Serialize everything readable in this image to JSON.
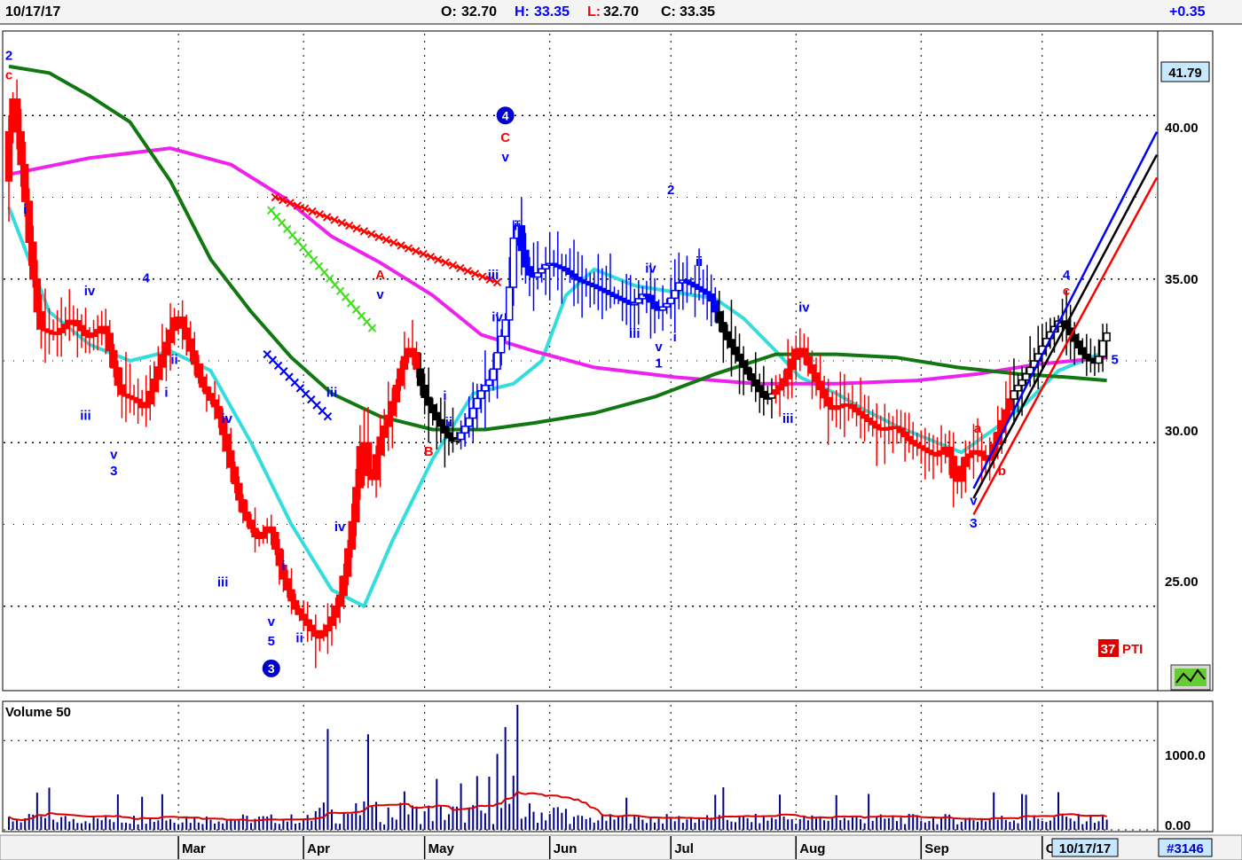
{
  "header": {
    "date": "10/17/17",
    "open_label": "O:",
    "open": "32.70",
    "high_label": "H:",
    "high": "33.35",
    "low_label": "L:",
    "low": "32.70",
    "close_label": "C:",
    "close": "33.35",
    "change": "+0.35"
  },
  "colors": {
    "up": "#0000ff",
    "down": "#ff0000",
    "neutral": "#000000",
    "ma_short": "#33dddd",
    "ma_mid": "#ee22ee",
    "ma_long": "#117711",
    "volume_bar": "#000088",
    "volume_ma": "#dd0000",
    "label_bg": "#c8e8ff"
  },
  "price_panel": {
    "last_price_label": "41.79",
    "y_ticks": [
      "40.00",
      "35.00",
      "30.00",
      "25.00"
    ],
    "indicator_value": "37",
    "indicator_name": "PTI"
  },
  "volume_panel": {
    "title": "Volume 50",
    "y_ticks": [
      "1000.0",
      "0.00"
    ]
  },
  "x_axis": {
    "months": [
      "Mar",
      "Apr",
      "May",
      "Jun",
      "Jul",
      "Aug",
      "Sep",
      "O"
    ],
    "current_date": "10/17/17",
    "symbol_id": "#3146"
  },
  "chart_data": {
    "type": "candlestick",
    "ylim": [
      22.5,
      42.5
    ],
    "volume_ylim": [
      0,
      1400
    ],
    "x_range_days": [
      0,
      248
    ],
    "month_starts": [
      {
        "label": "Mar",
        "day": 42
      },
      {
        "label": "Apr",
        "day": 73
      },
      {
        "label": "May",
        "day": 103
      },
      {
        "label": "Jun",
        "day": 134
      },
      {
        "label": "Jul",
        "day": 164
      },
      {
        "label": "Aug",
        "day": 195
      },
      {
        "label": "Sep",
        "day": 226
      },
      {
        "label": "O",
        "day": 256
      }
    ],
    "price_path": [
      [
        0,
        38.0
      ],
      [
        1,
        41.0
      ],
      [
        4,
        38.0
      ],
      [
        6,
        35.5
      ],
      [
        8,
        33.5
      ],
      [
        12,
        33.3
      ],
      [
        16,
        33.8
      ],
      [
        20,
        33.2
      ],
      [
        24,
        33.6
      ],
      [
        28,
        31.5
      ],
      [
        32,
        31.3
      ],
      [
        34,
        31.0
      ],
      [
        38,
        32.5
      ],
      [
        42,
        34.0
      ],
      [
        45,
        33.0
      ],
      [
        48,
        31.8
      ],
      [
        52,
        31.0
      ],
      [
        55,
        29.5
      ],
      [
        58,
        28.0
      ],
      [
        62,
        27.0
      ],
      [
        65,
        27.5
      ],
      [
        68,
        26.0
      ],
      [
        71,
        25.0
      ],
      [
        74,
        24.5
      ],
      [
        77,
        24.0
      ],
      [
        80,
        24.5
      ],
      [
        83,
        25.5
      ],
      [
        86,
        28.0
      ],
      [
        88,
        30.5
      ],
      [
        90,
        28.5
      ],
      [
        92,
        30.0
      ],
      [
        95,
        31.0
      ],
      [
        98,
        32.5
      ],
      [
        100,
        33.0
      ],
      [
        103,
        31.5
      ],
      [
        106,
        30.8
      ],
      [
        109,
        30.2
      ],
      [
        111,
        30.0
      ],
      [
        114,
        30.6
      ],
      [
        117,
        31.5
      ],
      [
        120,
        32.0
      ],
      [
        122,
        33.0
      ],
      [
        124,
        34.0
      ],
      [
        126,
        37.0
      ],
      [
        128,
        35.5
      ],
      [
        130,
        35.0
      ],
      [
        134,
        35.5
      ],
      [
        138,
        35.3
      ],
      [
        141,
        35.0
      ],
      [
        145,
        34.8
      ],
      [
        150,
        34.5
      ],
      [
        155,
        34.2
      ],
      [
        158,
        34.6
      ],
      [
        161,
        34.0
      ],
      [
        164,
        34.3
      ],
      [
        167,
        35.0
      ],
      [
        170,
        34.8
      ],
      [
        174,
        34.5
      ],
      [
        177,
        33.5
      ],
      [
        180,
        32.8
      ],
      [
        184,
        32.0
      ],
      [
        188,
        31.3
      ],
      [
        192,
        31.8
      ],
      [
        196,
        33.0
      ],
      [
        200,
        32.0
      ],
      [
        204,
        31.0
      ],
      [
        208,
        31.2
      ],
      [
        212,
        30.8
      ],
      [
        216,
        30.4
      ],
      [
        220,
        30.5
      ],
      [
        224,
        30.0
      ],
      [
        227,
        29.8
      ],
      [
        230,
        29.6
      ],
      [
        233,
        29.9
      ],
      [
        235,
        28.6
      ],
      [
        237,
        29.5
      ],
      [
        240,
        29.8
      ],
      [
        243,
        29.4
      ],
      [
        246,
        30.5
      ],
      [
        249,
        31.5
      ],
      [
        252,
        32.0
      ],
      [
        255,
        32.6
      ],
      [
        258,
        33.3
      ],
      [
        261,
        33.8
      ],
      [
        264,
        33.2
      ],
      [
        267,
        32.6
      ],
      [
        270,
        32.4
      ],
      [
        272,
        33.35
      ]
    ],
    "series": [
      {
        "name": "",
        "color_key": "ma_short",
        "points": [
          [
            0,
            37.2
          ],
          [
            10,
            34.0
          ],
          [
            20,
            33.0
          ],
          [
            30,
            32.5
          ],
          [
            40,
            32.8
          ],
          [
            50,
            32.2
          ],
          [
            60,
            30.0
          ],
          [
            70,
            27.5
          ],
          [
            80,
            25.5
          ],
          [
            88,
            25.0
          ],
          [
            95,
            27.0
          ],
          [
            105,
            29.5
          ],
          [
            115,
            31.5
          ],
          [
            125,
            31.8
          ],
          [
            132,
            32.5
          ],
          [
            138,
            34.5
          ],
          [
            145,
            35.3
          ],
          [
            155,
            34.8
          ],
          [
            165,
            34.6
          ],
          [
            175,
            34.4
          ],
          [
            182,
            33.8
          ],
          [
            190,
            32.8
          ],
          [
            196,
            32.0
          ],
          [
            205,
            31.5
          ],
          [
            212,
            31.0
          ],
          [
            220,
            30.5
          ],
          [
            228,
            30.1
          ],
          [
            236,
            29.7
          ],
          [
            244,
            30.4
          ],
          [
            252,
            31.2
          ],
          [
            260,
            32.2
          ],
          [
            266,
            32.5
          ],
          [
            272,
            32.8
          ]
        ]
      },
      {
        "name": "",
        "color_key": "ma_mid",
        "points": [
          [
            0,
            38.2
          ],
          [
            20,
            38.7
          ],
          [
            40,
            39.0
          ],
          [
            55,
            38.5
          ],
          [
            68,
            37.5
          ],
          [
            80,
            36.3
          ],
          [
            92,
            35.5
          ],
          [
            105,
            34.5
          ],
          [
            117,
            33.3
          ],
          [
            130,
            32.8
          ],
          [
            145,
            32.3
          ],
          [
            165,
            32.0
          ],
          [
            185,
            31.8
          ],
          [
            205,
            31.8
          ],
          [
            225,
            31.9
          ],
          [
            240,
            32.1
          ],
          [
            255,
            32.4
          ],
          [
            272,
            32.6
          ]
        ]
      },
      {
        "name": "",
        "color_key": "ma_long",
        "points": [
          [
            0,
            41.5
          ],
          [
            10,
            41.3
          ],
          [
            20,
            40.6
          ],
          [
            30,
            39.8
          ],
          [
            40,
            38.0
          ],
          [
            50,
            35.6
          ],
          [
            60,
            34.0
          ],
          [
            70,
            32.6
          ],
          [
            80,
            31.5
          ],
          [
            92,
            30.8
          ],
          [
            105,
            30.4
          ],
          [
            118,
            30.4
          ],
          [
            130,
            30.6
          ],
          [
            145,
            30.9
          ],
          [
            160,
            31.4
          ],
          [
            175,
            32.1
          ],
          [
            190,
            32.7
          ],
          [
            205,
            32.7
          ],
          [
            220,
            32.6
          ],
          [
            235,
            32.3
          ],
          [
            250,
            32.1
          ],
          [
            262,
            32.0
          ],
          [
            272,
            31.9
          ]
        ]
      }
    ],
    "wave_labels": [
      {
        "text": "2",
        "day": 0,
        "price": 41.7,
        "color": "up"
      },
      {
        "text": "c",
        "day": 0,
        "price": 41.1,
        "color": "down"
      },
      {
        "text": "i",
        "day": 4,
        "price": 37.0,
        "color": "up"
      },
      {
        "text": "iv",
        "day": 20,
        "price": 34.5,
        "color": "up"
      },
      {
        "text": "iii",
        "day": 19,
        "price": 30.7,
        "color": "up"
      },
      {
        "text": "v",
        "day": 26,
        "price": 29.5,
        "color": "up"
      },
      {
        "text": "3",
        "day": 26,
        "price": 29.0,
        "color": "up"
      },
      {
        "text": "4",
        "day": 34,
        "price": 34.9,
        "color": "up"
      },
      {
        "text": "ii",
        "day": 41,
        "price": 32.4,
        "color": "up"
      },
      {
        "text": "i",
        "day": 39,
        "price": 31.4,
        "color": "up"
      },
      {
        "text": "iii",
        "day": 53,
        "price": 25.6,
        "color": "up"
      },
      {
        "text": "iv",
        "day": 54,
        "price": 30.6,
        "color": "up"
      },
      {
        "text": "i",
        "day": 68,
        "price": 26.1,
        "color": "up"
      },
      {
        "text": "ii",
        "day": 72,
        "price": 23.9,
        "color": "up"
      },
      {
        "text": "v",
        "day": 65,
        "price": 24.4,
        "color": "up"
      },
      {
        "text": "5",
        "day": 65,
        "price": 23.8,
        "color": "up"
      },
      {
        "text": "iii",
        "day": 80,
        "price": 31.4,
        "color": "up"
      },
      {
        "text": "iv",
        "day": 82,
        "price": 27.3,
        "color": "up"
      },
      {
        "text": "A",
        "day": 92,
        "price": 35.0,
        "color": "down"
      },
      {
        "text": "v",
        "day": 92,
        "price": 34.4,
        "color": "up"
      },
      {
        "text": "i",
        "day": 108,
        "price": 31.3,
        "color": "up"
      },
      {
        "text": "ii",
        "day": 109,
        "price": 30.5,
        "color": "up"
      },
      {
        "text": "B",
        "day": 104,
        "price": 29.6,
        "color": "down"
      },
      {
        "text": "iii",
        "day": 120,
        "price": 35.0,
        "color": "up"
      },
      {
        "text": "iv",
        "day": 121,
        "price": 33.7,
        "color": "up"
      },
      {
        "text": "C",
        "day": 123,
        "price": 39.2,
        "color": "down"
      },
      {
        "text": "v",
        "day": 123,
        "price": 38.6,
        "color": "up"
      },
      {
        "text": "ii",
        "day": 126,
        "price": 36.5,
        "color": "up"
      },
      {
        "text": "iv",
        "day": 159,
        "price": 35.2,
        "color": "up"
      },
      {
        "text": "iii",
        "day": 155,
        "price": 33.2,
        "color": "up"
      },
      {
        "text": "v",
        "day": 161,
        "price": 32.8,
        "color": "up"
      },
      {
        "text": "1",
        "day": 161,
        "price": 32.3,
        "color": "up"
      },
      {
        "text": "2",
        "day": 164,
        "price": 37.6,
        "color": "up"
      },
      {
        "text": "i",
        "day": 165,
        "price": 33.1,
        "color": "up"
      },
      {
        "text": "ii",
        "day": 171,
        "price": 35.4,
        "color": "up"
      },
      {
        "text": "iv",
        "day": 197,
        "price": 34.0,
        "color": "up"
      },
      {
        "text": "iii",
        "day": 193,
        "price": 30.6,
        "color": "up"
      },
      {
        "text": "a",
        "day": 240,
        "price": 30.3,
        "color": "down"
      },
      {
        "text": "b",
        "day": 246,
        "price": 29.0,
        "color": "down"
      },
      {
        "text": "v",
        "day": 239,
        "price": 28.1,
        "color": "up"
      },
      {
        "text": "3",
        "day": 239,
        "price": 27.4,
        "color": "up"
      },
      {
        "text": "4",
        "day": 262,
        "price": 35.0,
        "color": "up"
      },
      {
        "text": "c",
        "day": 262,
        "price": 34.5,
        "color": "down"
      },
      {
        "text": "5",
        "day": 274,
        "price": 32.4,
        "color": "up"
      }
    ],
    "wave_circles": [
      {
        "text": "4",
        "day": 123,
        "price": 40.0
      },
      {
        "text": "3",
        "day": 65,
        "price": 23.1
      }
    ],
    "marker_lines": [
      {
        "color": "down",
        "from": [
          66,
          37.5
        ],
        "to": [
          121,
          34.9
        ]
      },
      {
        "color": "#44dd22",
        "from": [
          65,
          37.1
        ],
        "to": [
          90,
          33.5
        ]
      },
      {
        "color": "up",
        "from": [
          64,
          32.7
        ],
        "to": [
          79,
          30.8
        ]
      }
    ],
    "channel_lines": [
      {
        "color": "up",
        "from": [
          239,
          28.6
        ],
        "to": [
          291,
          39.5
        ]
      },
      {
        "color": "neutral",
        "from": [
          239,
          28.3
        ],
        "to": [
          291,
          38.8
        ]
      },
      {
        "color": "down",
        "from": [
          239,
          27.8
        ],
        "to": [
          291,
          38.1
        ]
      }
    ],
    "volume_spikes": [
      {
        "day": 79,
        "value": 1130
      },
      {
        "day": 89,
        "value": 1070
      },
      {
        "day": 123,
        "value": 1150
      },
      {
        "day": 126,
        "value": 1400
      },
      {
        "day": 121,
        "value": 850
      },
      {
        "day": 112,
        "value": 520
      }
    ]
  }
}
